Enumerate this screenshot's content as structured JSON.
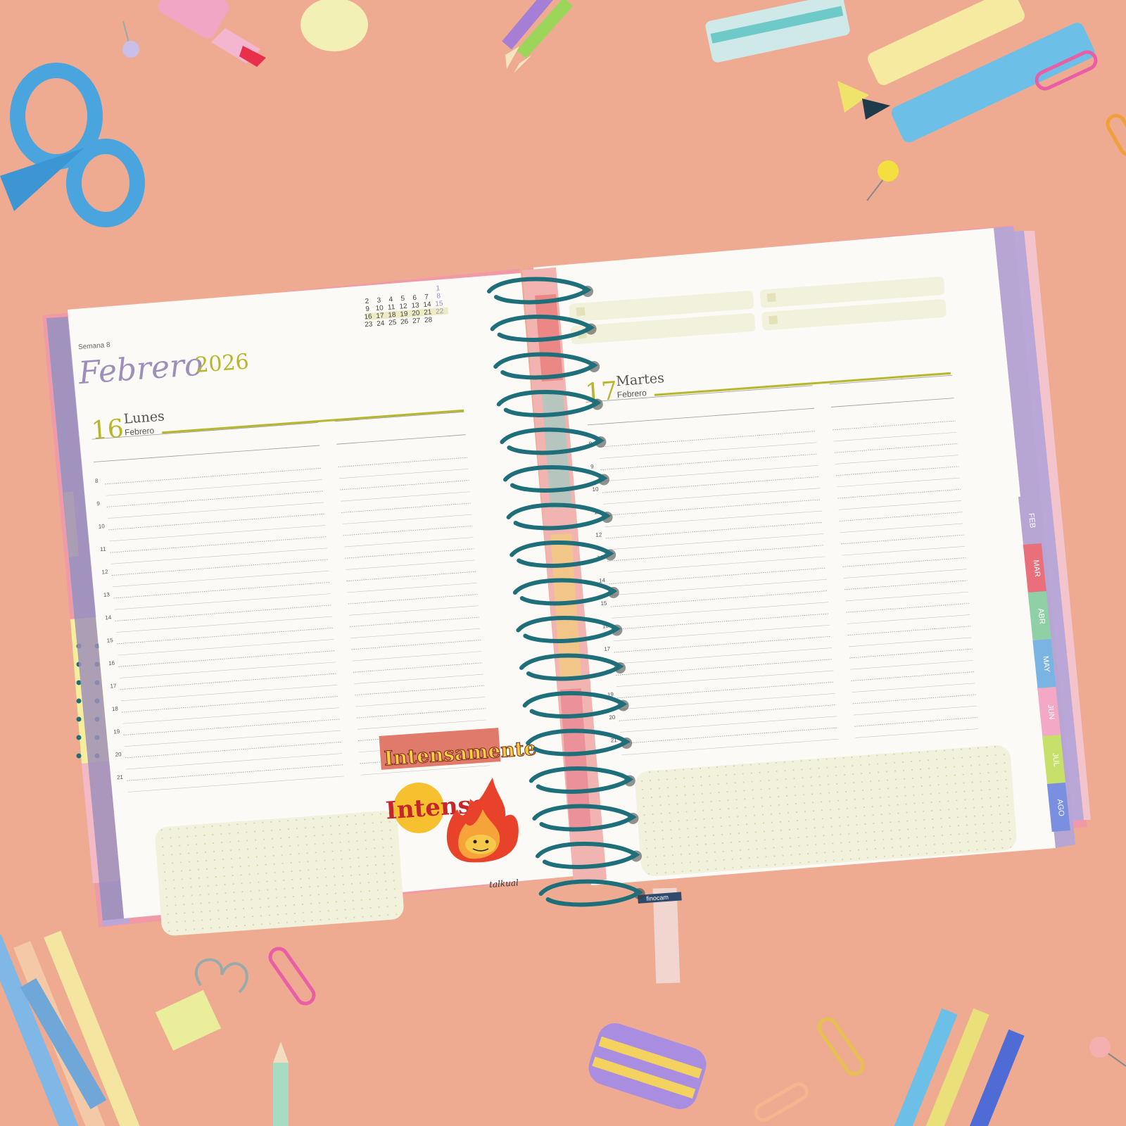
{
  "colors": {
    "background": "#eeab92",
    "page": "#fbfaf6",
    "accent_lime": "#b8b62a",
    "accent_purple": "#9d8fba",
    "spiral": "#1f6f7a",
    "note_box": "#f2f1dc"
  },
  "left_page": {
    "week": "Semana 8",
    "month": "Febrero",
    "year": "2026",
    "mini_calendar": {
      "rows": [
        [
          "",
          "",
          "",
          "",
          "",
          "",
          "1"
        ],
        [
          "2",
          "3",
          "4",
          "5",
          "6",
          "7",
          "8"
        ],
        [
          "9",
          "10",
          "11",
          "12",
          "13",
          "14",
          "15"
        ],
        [
          "16",
          "17",
          "18",
          "19",
          "20",
          "21",
          "22"
        ],
        [
          "23",
          "24",
          "25",
          "26",
          "27",
          "28",
          ""
        ]
      ]
    },
    "day_number": "16",
    "day_name": "Lunes",
    "day_month": "Febrero",
    "hours": [
      "8",
      "9",
      "10",
      "11",
      "12",
      "13",
      "14",
      "15",
      "16",
      "17",
      "18",
      "19",
      "20",
      "21"
    ],
    "sticker": {
      "title": "Intensamente",
      "word": "Intenso",
      "signature": "talkual"
    }
  },
  "right_page": {
    "day_number": "17",
    "day_name": "Martes",
    "day_month": "Febrero",
    "hours": [
      "8",
      "9",
      "10",
      "11",
      "12",
      "13",
      "14",
      "15",
      "16",
      "17",
      "18",
      "19",
      "20",
      "21"
    ],
    "brand": "finocam",
    "month_tabs": [
      "FEB",
      "MAR",
      "ABR",
      "MAY",
      "JUN",
      "JUL",
      "AGO"
    ]
  }
}
